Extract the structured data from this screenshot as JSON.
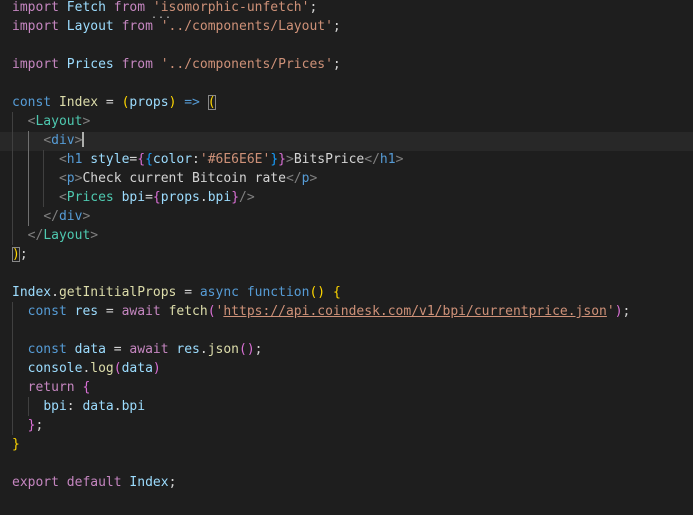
{
  "theme": {
    "background": "#1e1e1e",
    "keyword": "#c586c0",
    "storage": "#569cd6",
    "function": "#dcdcaa",
    "variable": "#9cdcfe",
    "string": "#ce9178",
    "tag": "#569cd6",
    "component": "#4ec9b0",
    "punctuation": "#808080",
    "bracket_gold": "#ffd700",
    "bracket_orchid": "#da70d6",
    "bracket_blue": "#179fff"
  },
  "editor": {
    "language": "javascript-react",
    "hover_hint_dots": "...",
    "lines": [
      [
        {
          "t": "import",
          "c": "c-kw"
        },
        {
          "t": " Fetch ",
          "c": "c-var"
        },
        {
          "t": "from",
          "c": "c-kw"
        },
        {
          "t": " ",
          "c": "c-op"
        },
        {
          "t": "'isomorphic-unfetch'",
          "c": "c-str"
        },
        {
          "t": ";",
          "c": "c-op"
        }
      ],
      [
        {
          "t": "import",
          "c": "c-kw"
        },
        {
          "t": " Layout ",
          "c": "c-var"
        },
        {
          "t": "from",
          "c": "c-kw"
        },
        {
          "t": " ",
          "c": "c-op"
        },
        {
          "t": "'../components/Layout'",
          "c": "c-str"
        },
        {
          "t": ";",
          "c": "c-op"
        }
      ],
      [],
      [
        {
          "t": "import",
          "c": "c-kw"
        },
        {
          "t": " Prices ",
          "c": "c-var"
        },
        {
          "t": "from",
          "c": "c-kw"
        },
        {
          "t": " ",
          "c": "c-op"
        },
        {
          "t": "'../components/Prices'",
          "c": "c-str"
        },
        {
          "t": ";",
          "c": "c-op"
        }
      ],
      [],
      [
        {
          "t": "const",
          "c": "c-const"
        },
        {
          "t": " ",
          "c": "c-op"
        },
        {
          "t": "Index",
          "c": "c-fn"
        },
        {
          "t": " = ",
          "c": "c-op"
        },
        {
          "t": "(",
          "c": "c-br1"
        },
        {
          "t": "props",
          "c": "c-var"
        },
        {
          "t": ")",
          "c": "c-br1"
        },
        {
          "t": " ",
          "c": "c-op"
        },
        {
          "t": "=>",
          "c": "c-const"
        },
        {
          "t": " ",
          "c": "c-op"
        },
        {
          "t": "(",
          "c": "c-br1",
          "box": true
        }
      ],
      [
        {
          "t": "  ",
          "c": "c-op"
        },
        {
          "t": "<",
          "c": "c-tagp"
        },
        {
          "t": "Layout",
          "c": "c-comp"
        },
        {
          "t": ">",
          "c": "c-tagp"
        }
      ],
      [
        {
          "t": "    ",
          "c": "c-op"
        },
        {
          "t": "<",
          "c": "c-tagp"
        },
        {
          "t": "div",
          "c": "c-tag"
        },
        {
          "t": ">",
          "c": "c-tagp",
          "cursor": true
        }
      ],
      [
        {
          "t": "      ",
          "c": "c-op"
        },
        {
          "t": "<",
          "c": "c-tagp"
        },
        {
          "t": "h1",
          "c": "c-tag"
        },
        {
          "t": " ",
          "c": "c-op"
        },
        {
          "t": "style",
          "c": "c-attr"
        },
        {
          "t": "=",
          "c": "c-op"
        },
        {
          "t": "{",
          "c": "c-br2"
        },
        {
          "t": "{",
          "c": "c-br3"
        },
        {
          "t": "color",
          "c": "c-attr"
        },
        {
          "t": ":",
          "c": "c-op"
        },
        {
          "t": "'#6E6E6E'",
          "c": "c-str"
        },
        {
          "t": "}",
          "c": "c-br3"
        },
        {
          "t": "}",
          "c": "c-br2"
        },
        {
          "t": ">",
          "c": "c-tagp"
        },
        {
          "t": "BitsPrice",
          "c": "c-txt"
        },
        {
          "t": "</",
          "c": "c-tagp"
        },
        {
          "t": "h1",
          "c": "c-tag"
        },
        {
          "t": ">",
          "c": "c-tagp"
        }
      ],
      [
        {
          "t": "      ",
          "c": "c-op"
        },
        {
          "t": "<",
          "c": "c-tagp"
        },
        {
          "t": "p",
          "c": "c-tag"
        },
        {
          "t": ">",
          "c": "c-tagp"
        },
        {
          "t": "Check current Bitcoin rate",
          "c": "c-txt"
        },
        {
          "t": "</",
          "c": "c-tagp"
        },
        {
          "t": "p",
          "c": "c-tag"
        },
        {
          "t": ">",
          "c": "c-tagp"
        }
      ],
      [
        {
          "t": "      ",
          "c": "c-op"
        },
        {
          "t": "<",
          "c": "c-tagp"
        },
        {
          "t": "Prices",
          "c": "c-comp"
        },
        {
          "t": " ",
          "c": "c-op"
        },
        {
          "t": "bpi",
          "c": "c-attr"
        },
        {
          "t": "=",
          "c": "c-op"
        },
        {
          "t": "{",
          "c": "c-br2"
        },
        {
          "t": "props",
          "c": "c-var"
        },
        {
          "t": ".",
          "c": "c-op"
        },
        {
          "t": "bpi",
          "c": "c-var"
        },
        {
          "t": "}",
          "c": "c-br2"
        },
        {
          "t": "/>",
          "c": "c-tagp"
        }
      ],
      [
        {
          "t": "    ",
          "c": "c-op"
        },
        {
          "t": "</",
          "c": "c-tagp"
        },
        {
          "t": "div",
          "c": "c-tag"
        },
        {
          "t": ">",
          "c": "c-tagp"
        }
      ],
      [
        {
          "t": "  ",
          "c": "c-op"
        },
        {
          "t": "</",
          "c": "c-tagp"
        },
        {
          "t": "Layout",
          "c": "c-comp"
        },
        {
          "t": ">",
          "c": "c-tagp"
        }
      ],
      [
        {
          "t": ")",
          "c": "c-br1",
          "box": true
        },
        {
          "t": ";",
          "c": "c-op"
        }
      ],
      [],
      [
        {
          "t": "Index",
          "c": "c-var"
        },
        {
          "t": ".",
          "c": "c-op"
        },
        {
          "t": "getInitialProps",
          "c": "c-fn"
        },
        {
          "t": " = ",
          "c": "c-op"
        },
        {
          "t": "async",
          "c": "c-const"
        },
        {
          "t": " ",
          "c": "c-op"
        },
        {
          "t": "function",
          "c": "c-const"
        },
        {
          "t": "()",
          "c": "c-br1"
        },
        {
          "t": " ",
          "c": "c-op"
        },
        {
          "t": "{",
          "c": "c-br1"
        }
      ],
      [
        {
          "t": "  ",
          "c": "c-op"
        },
        {
          "t": "const",
          "c": "c-const"
        },
        {
          "t": " ",
          "c": "c-op"
        },
        {
          "t": "res",
          "c": "c-var"
        },
        {
          "t": " = ",
          "c": "c-op"
        },
        {
          "t": "await",
          "c": "c-kw"
        },
        {
          "t": " ",
          "c": "c-op"
        },
        {
          "t": "fetch",
          "c": "c-fn"
        },
        {
          "t": "(",
          "c": "c-br2"
        },
        {
          "t": "'",
          "c": "c-str"
        },
        {
          "t": "https://api.coindesk.com/v1/bpi/currentprice.json",
          "c": "c-str",
          "url": true
        },
        {
          "t": "'",
          "c": "c-str"
        },
        {
          "t": ")",
          "c": "c-br2"
        },
        {
          "t": ";",
          "c": "c-op"
        }
      ],
      [],
      [
        {
          "t": "  ",
          "c": "c-op"
        },
        {
          "t": "const",
          "c": "c-const"
        },
        {
          "t": " ",
          "c": "c-op"
        },
        {
          "t": "data",
          "c": "c-var"
        },
        {
          "t": " = ",
          "c": "c-op"
        },
        {
          "t": "await",
          "c": "c-kw"
        },
        {
          "t": " ",
          "c": "c-op"
        },
        {
          "t": "res",
          "c": "c-var"
        },
        {
          "t": ".",
          "c": "c-op"
        },
        {
          "t": "json",
          "c": "c-fn"
        },
        {
          "t": "()",
          "c": "c-br2"
        },
        {
          "t": ";",
          "c": "c-op"
        }
      ],
      [
        {
          "t": "  ",
          "c": "c-op"
        },
        {
          "t": "console",
          "c": "c-var"
        },
        {
          "t": ".",
          "c": "c-op"
        },
        {
          "t": "log",
          "c": "c-fn"
        },
        {
          "t": "(",
          "c": "c-br2"
        },
        {
          "t": "data",
          "c": "c-var"
        },
        {
          "t": ")",
          "c": "c-br2"
        }
      ],
      [
        {
          "t": "  ",
          "c": "c-op"
        },
        {
          "t": "return",
          "c": "c-kw"
        },
        {
          "t": " ",
          "c": "c-op"
        },
        {
          "t": "{",
          "c": "c-br2"
        }
      ],
      [
        {
          "t": "    ",
          "c": "c-op"
        },
        {
          "t": "bpi",
          "c": "c-var"
        },
        {
          "t": ": ",
          "c": "c-op"
        },
        {
          "t": "data",
          "c": "c-var"
        },
        {
          "t": ".",
          "c": "c-op"
        },
        {
          "t": "bpi",
          "c": "c-var"
        }
      ],
      [
        {
          "t": "  ",
          "c": "c-op"
        },
        {
          "t": "}",
          "c": "c-br2"
        },
        {
          "t": ";",
          "c": "c-op"
        }
      ],
      [
        {
          "t": "}",
          "c": "c-br1"
        }
      ],
      [],
      [
        {
          "t": "export",
          "c": "c-kw"
        },
        {
          "t": " ",
          "c": "c-op"
        },
        {
          "t": "default",
          "c": "c-kw"
        },
        {
          "t": " ",
          "c": "c-op"
        },
        {
          "t": "Index",
          "c": "c-var"
        },
        {
          "t": ";",
          "c": "c-op"
        }
      ]
    ]
  }
}
